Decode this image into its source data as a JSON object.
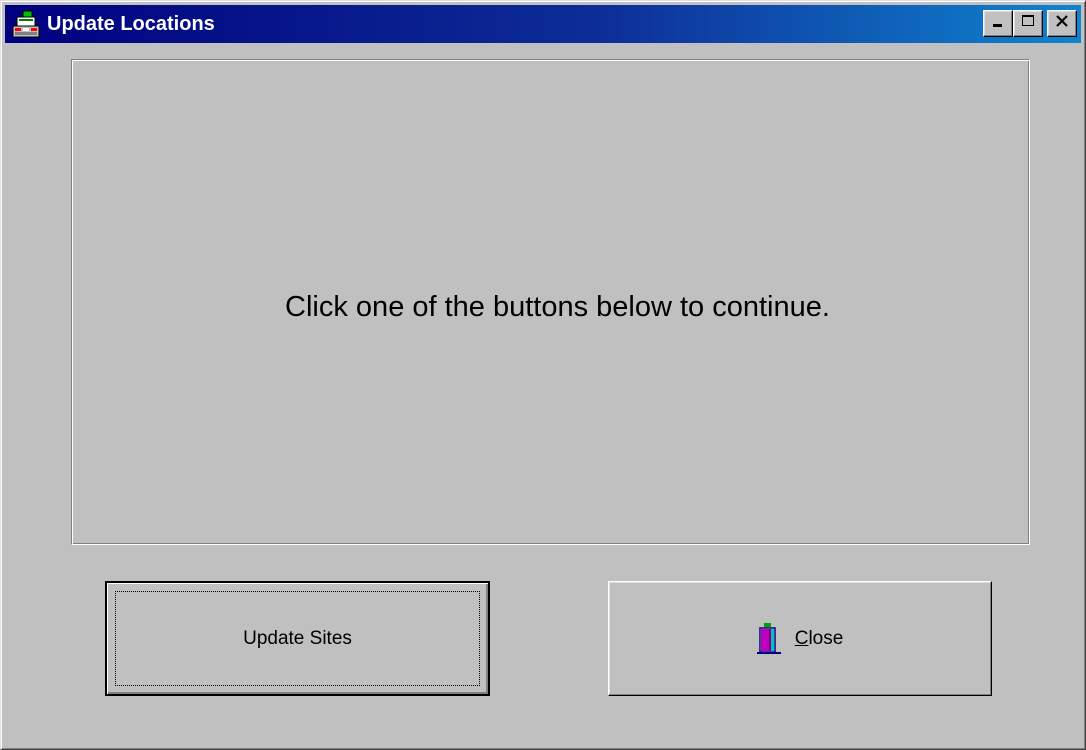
{
  "window": {
    "title": "Update Locations",
    "icon": "register-icon",
    "controls": {
      "minimize_icon": "minimize-icon",
      "maximize_icon": "maximize-icon",
      "close_icon": "close-icon"
    }
  },
  "message": "Click one of the buttons below to continue.",
  "buttons": {
    "update_sites": {
      "label": "Update Sites"
    },
    "close": {
      "label_hotkey": "C",
      "label_rest": "lose",
      "icon": "door-exit-icon"
    }
  },
  "colors": {
    "window_bg": "#c0c0c0",
    "title_start": "#000080",
    "title_end": "#1084d0"
  }
}
